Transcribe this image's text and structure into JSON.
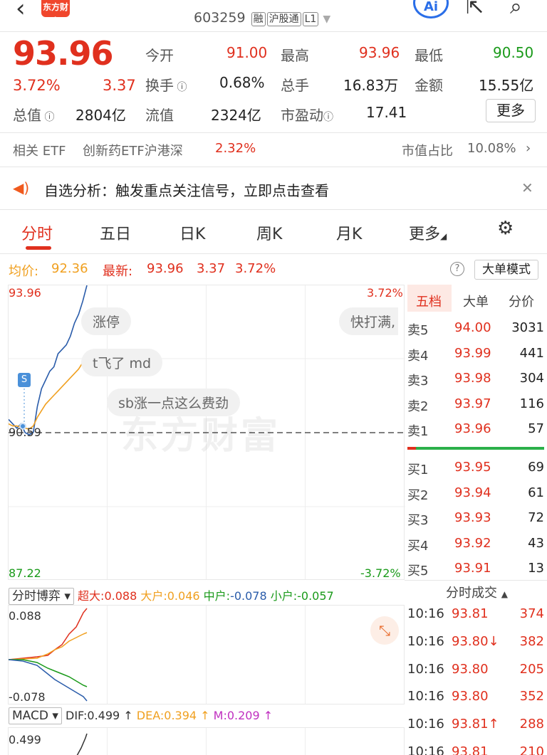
{
  "header": {
    "back_icon": "chevron-left-icon",
    "logo_text": "东方财富",
    "code": "603259",
    "tags": [
      "融",
      "沪股通",
      "L1"
    ],
    "ai_label": "Ai"
  },
  "quote": {
    "price": "93.96",
    "change_pct": "3.72%",
    "change": "3.37",
    "open_label": "今开",
    "open": "91.00",
    "high_label": "最高",
    "high": "93.96",
    "low_label": "最低",
    "low": "90.50",
    "turnover_label": "换手",
    "turnover": "0.68%",
    "volume_label": "总手",
    "volume": "16.83万",
    "amount_label": "金额",
    "amount": "15.55亿",
    "mktcap_label": "总值",
    "mktcap": "2804亿",
    "float_label": "流值",
    "float": "2324亿",
    "pe_label": "市盈动",
    "pe": "17.41",
    "more_label": "更多"
  },
  "etf": {
    "label": "相关 ETF",
    "name": "创新药ETF沪港深",
    "pct": "2.32%",
    "share_label": "市值占比",
    "share": "10.08%"
  },
  "notice": {
    "text": "自选分析：触发重点关注信号，立即点击查看"
  },
  "tabs": [
    "分时",
    "五日",
    "日K",
    "周K",
    "月K",
    "更多"
  ],
  "summary": {
    "avg_label": "均价:",
    "avg": "92.36",
    "latest_label": "最新:",
    "latest": "93.96",
    "chg": "3.37",
    "pct": "3.72%",
    "big_mode": "大单模式"
  },
  "chart": {
    "y_top": "93.96",
    "y_mid": "90.59",
    "y_bottom": "87.22",
    "pct_top": "3.72%",
    "pct_bottom": "-3.72%",
    "marker": "S",
    "comments": [
      "涨停",
      "t飞了 md",
      "sb涨一点这么费劲",
      "快打满,"
    ],
    "watermark": "东方财富"
  },
  "chart_data": {
    "type": "line",
    "ylim": [
      87.22,
      93.96
    ],
    "series": [
      {
        "name": "price",
        "color": "#2a5caa",
        "values": [
          90.9,
          90.8,
          90.7,
          90.8,
          90.6,
          90.55,
          90.6,
          91.2,
          91.6,
          91.8,
          92.0,
          92.1,
          92.4,
          92.5,
          92.6,
          92.8,
          93.1,
          93.3,
          93.6,
          93.96
        ]
      },
      {
        "name": "avg",
        "color": "#f0a020",
        "values": [
          90.8,
          90.75,
          90.75,
          90.72,
          90.7,
          90.68,
          90.75,
          90.95,
          91.1,
          91.25,
          91.35,
          91.45,
          91.55,
          91.65,
          91.75,
          91.85,
          91.95,
          92.05,
          92.2,
          92.36
        ]
      }
    ]
  },
  "orderbook": {
    "tabs": [
      "五档",
      "大单",
      "分价"
    ],
    "asks": [
      {
        "label": "卖5",
        "price": "94.00",
        "vol": "3031"
      },
      {
        "label": "卖4",
        "price": "93.99",
        "vol": "441"
      },
      {
        "label": "卖3",
        "price": "93.98",
        "vol": "304"
      },
      {
        "label": "卖2",
        "price": "93.97",
        "vol": "116"
      },
      {
        "label": "卖1",
        "price": "93.96",
        "vol": "57"
      }
    ],
    "bids": [
      {
        "label": "买1",
        "price": "93.95",
        "vol": "69"
      },
      {
        "label": "买2",
        "price": "93.94",
        "vol": "61"
      },
      {
        "label": "买3",
        "price": "93.93",
        "vol": "72"
      },
      {
        "label": "买4",
        "price": "93.92",
        "vol": "43"
      },
      {
        "label": "买5",
        "price": "93.91",
        "vol": "13"
      }
    ]
  },
  "trades": {
    "title": "分时成交",
    "rows": [
      {
        "time": "10:16",
        "price": "93.81",
        "vol": "374"
      },
      {
        "time": "10:16",
        "price": "93.80↓",
        "vol": "382"
      },
      {
        "time": "10:16",
        "price": "93.80",
        "vol": "205"
      },
      {
        "time": "10:16",
        "price": "93.80",
        "vol": "352"
      },
      {
        "time": "10:16",
        "price": "93.81↑",
        "vol": "288"
      },
      {
        "time": "10:16",
        "price": "93.81",
        "vol": "210"
      }
    ]
  },
  "flow": {
    "select": "分时博弈",
    "xl_label": "超大:",
    "xl": "0.088",
    "l_label": "大户:",
    "l": "0.046",
    "m_label": "中户:",
    "m": "-0.078",
    "s_label": "小户:",
    "s": "-0.057",
    "y_top": "0.088",
    "y_bottom": "-0.078",
    "colors": {
      "xl": "#e0301e",
      "l": "#f0a020",
      "m": "#1a9a1a",
      "s": "#2a5caa"
    }
  },
  "macd": {
    "select": "MACD",
    "dif": "DIF:0.499 ↑",
    "dea": "DEA:0.394 ↑",
    "m": "M:0.209 ↑",
    "y_top": "0.499"
  }
}
